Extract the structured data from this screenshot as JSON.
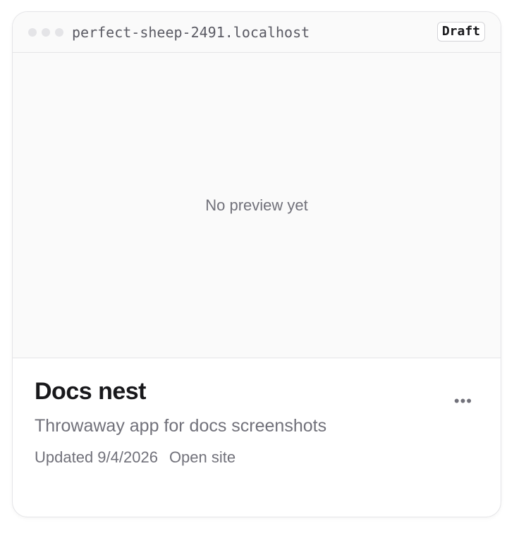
{
  "browser_bar": {
    "hostname": "perfect-sheep-2491.localhost",
    "badge": "Draft"
  },
  "preview": {
    "placeholder": "No preview yet"
  },
  "project": {
    "name": "Docs nest",
    "description": "Throwaway app for docs screenshots",
    "updated": "Updated 9/4/2026",
    "open_site_label": "Open site",
    "more_label": "•••"
  },
  "icons": {
    "window_dots": "window-dots-icon",
    "more": "more-icon"
  },
  "colors": {
    "border": "#e4e4e7",
    "muted_text": "#71717a",
    "title_text": "#18181b",
    "preview_bg": "#fafafa"
  }
}
